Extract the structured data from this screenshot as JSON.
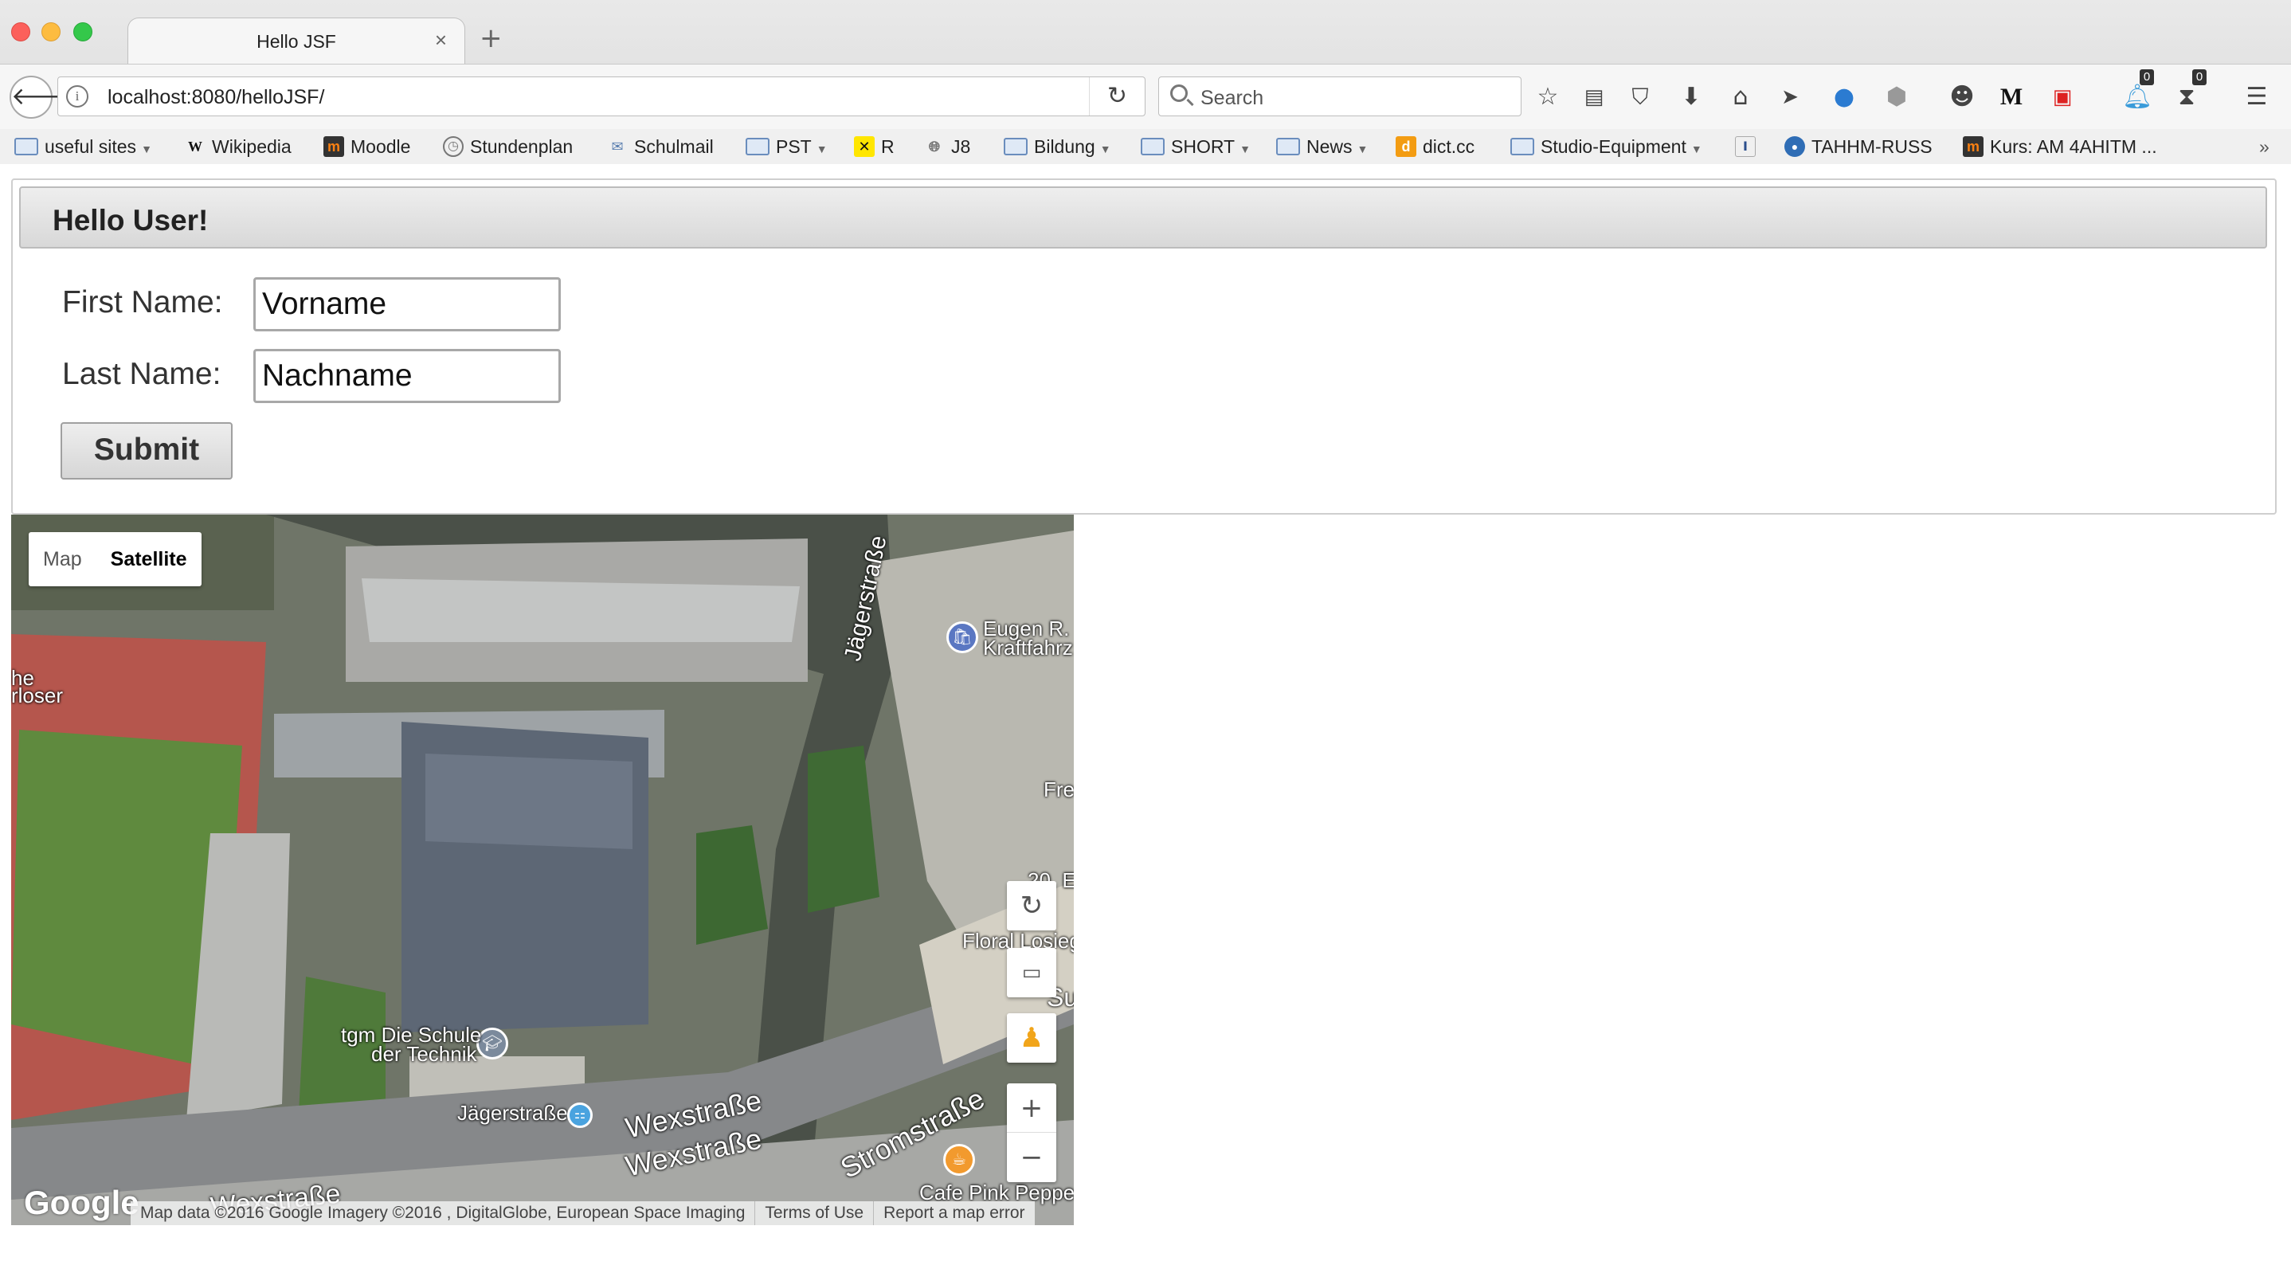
{
  "window": {
    "tab_title": "Hello JSF"
  },
  "navbar": {
    "url_host": "localhost",
    "url_rest": ":8080/helloJSF/",
    "search_placeholder": "Search",
    "badge_a": "0",
    "badge_b": "0",
    "medium_label": "M"
  },
  "bookmarks": [
    {
      "label": "useful sites",
      "type": "folder"
    },
    {
      "label": "Wikipedia",
      "type": "link"
    },
    {
      "label": "Moodle",
      "type": "link"
    },
    {
      "label": "Stundenplan",
      "type": "link"
    },
    {
      "label": "Schulmail",
      "type": "link"
    },
    {
      "label": "PST",
      "type": "folder"
    },
    {
      "label": "R",
      "type": "link"
    },
    {
      "label": "J8",
      "type": "link"
    },
    {
      "label": "Bildung",
      "type": "folder"
    },
    {
      "label": "SHORT",
      "type": "folder"
    },
    {
      "label": "News",
      "type": "folder"
    },
    {
      "label": "dict.cc",
      "type": "link"
    },
    {
      "label": "Studio-Equipment",
      "type": "folder"
    },
    {
      "label": "TAHHM-RUSS",
      "type": "link"
    },
    {
      "label": "Kurs: AM 4AHITM ...",
      "type": "link"
    }
  ],
  "form": {
    "title": "Hello User!",
    "first_name_label": "First Name:",
    "first_name_value": "Vorname",
    "last_name_label": "Last Name:",
    "last_name_value": "Nachname",
    "submit_label": "Submit"
  },
  "map": {
    "type_map": "Map",
    "type_satellite": "Satellite",
    "selected_type": "Satellite",
    "labels": {
      "jaegerstrasse_vertical": "Jägerstraße",
      "eugen_1": "Eugen R. I",
      "eugen_2": "Kraftfahrz",
      "tgm_1": "tgm Die Schule",
      "tgm_2": "der Technik",
      "jaegerstrasse_stop": "Jägerstraße",
      "wexstrasse_1": "Wexstraße",
      "wexstrasse_2": "Wexstraße",
      "wexstrasse_3": "Wexstraße",
      "stromstrasse": "Stromstraße",
      "floral": "Floral Losieg",
      "cafe": "Cafe Pink Pepper",
      "fre": "Fre",
      "su": "Su",
      "num": "20, E",
      "loser_1": "he",
      "loser_2": "rloser"
    },
    "logo": "Google",
    "attribution": [
      "Map data ©2016 Google Imagery ©2016 , DigitalGlobe, European Space Imaging",
      "Terms of Use",
      "Report a map error"
    ]
  }
}
